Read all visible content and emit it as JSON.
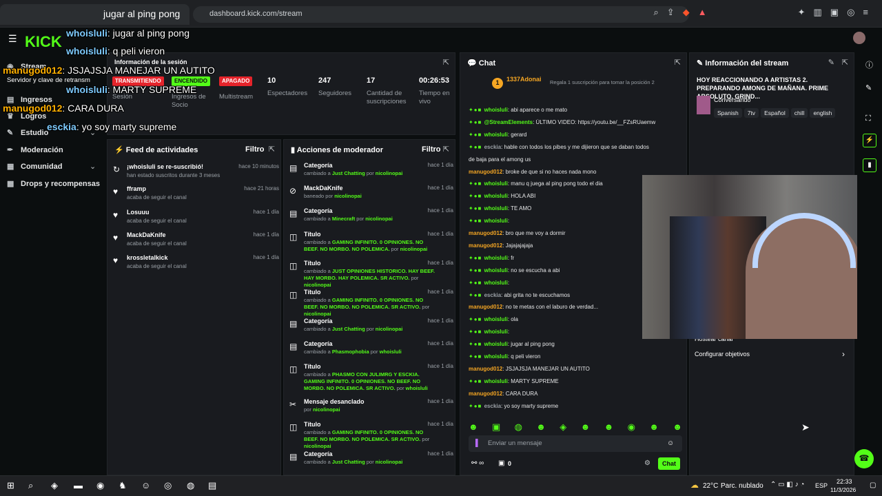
{
  "browser": {
    "tab_title": "jugar al ping pong",
    "url": "dashboard.kick.com/stream"
  },
  "app": {
    "logo": "KICK"
  },
  "sidebar": {
    "items": [
      {
        "label": "Stream",
        "icon": "broadcast-icon"
      },
      {
        "label": "Ingresos",
        "icon": "money-icon"
      },
      {
        "label": "Logros",
        "icon": "trophy-icon"
      },
      {
        "label": "Estudio",
        "icon": "studio-icon"
      },
      {
        "label": "Moderación",
        "icon": "wrench-icon"
      },
      {
        "label": "Comunidad",
        "icon": "community-icon"
      },
      {
        "label": "Drops y recompensas",
        "icon": "gift-icon"
      }
    ],
    "sub_info": "Información de la sesión",
    "sub_key": "Servidor y clave de retransm"
  },
  "session": {
    "badges": [
      "TRANSMITIENDO",
      "ENCENDIDO",
      "APAGADO"
    ],
    "labels": [
      "Sesión",
      "Ingresos de Socio",
      "Multistream"
    ],
    "stats": [
      {
        "value": "10",
        "label": "Espectadores"
      },
      {
        "value": "247",
        "label": "Seguidores"
      },
      {
        "value": "17",
        "label": "Cantidad de suscripciones"
      },
      {
        "value": "00:26:53",
        "label": "Tiempo en vivo"
      }
    ]
  },
  "feed": {
    "title": "Feed de actividades",
    "filter": "Filtro",
    "items": [
      {
        "name": "¡whoisluli se re-suscribió!",
        "sub": "han estado suscritos durante 3 meses",
        "time": "hace 10 minutos"
      },
      {
        "name": "fframp",
        "sub": "acaba de seguir el canal",
        "time": "hace 21 horas"
      },
      {
        "name": "Losuuu",
        "sub": "acaba de seguir el canal",
        "time": "hace 1 día"
      },
      {
        "name": "MackDaKnife",
        "sub": "acaba de seguir el canal",
        "time": "hace 1 día"
      },
      {
        "name": "krossletalkick",
        "sub": "acaba de seguir el canal",
        "time": "hace 1 día"
      }
    ]
  },
  "mod": {
    "title": "Acciones de moderador",
    "filter": "Filtro",
    "items": [
      {
        "name": "Categoría",
        "pre": "cambiado a ",
        "hl": "Just Chatting",
        "post": " por ",
        "by": "nicolinopai",
        "time": "hace 1 día"
      },
      {
        "name": "MackDaKnife",
        "pre": "baneado por ",
        "hl": "",
        "post": "",
        "by": "nicolinopai",
        "time": "hace 1 día"
      },
      {
        "name": "Categoría",
        "pre": "cambiado a ",
        "hl": "Minecraft",
        "post": " por ",
        "by": "nicolinopai",
        "time": "hace 1 día"
      },
      {
        "name": "Título",
        "pre": "cambiado a ",
        "hl": "GAMING INFINITO. 0 OPINIONES. NO BEEF. NO MORBO. NO POLEMICA.",
        "post": " por ",
        "by": "nicolinopai",
        "time": "hace 1 día"
      },
      {
        "name": "Título",
        "pre": "cambiado a ",
        "hl": "JUST OPINIONES HISTORICO. HAY BEEF. HAY MORBO. HAY POLEMICA. SR ACTIVO.",
        "post": " por ",
        "by": "nicolinopai",
        "time": "hace 1 día"
      },
      {
        "name": "Título",
        "pre": "cambiado a ",
        "hl": "GAMING INFINITO. 0 OPINIONES. NO BEEF. NO MORBO. NO POLEMICA. SR ACTIVO.",
        "post": " por ",
        "by": "nicolinopai",
        "time": "hace 1 día"
      },
      {
        "name": "Categoría",
        "pre": "cambiado a ",
        "hl": "Just Chatting",
        "post": " por ",
        "by": "nicolinopai",
        "time": "hace 1 día"
      },
      {
        "name": "Categoría",
        "pre": "cambiado a ",
        "hl": "Phasmophobia",
        "post": " por ",
        "by": "whoisluli",
        "time": "hace 1 día"
      },
      {
        "name": "Título",
        "pre": "cambiado a ",
        "hl": "PHASMO CON JULIMRG Y ESCKIA. GAMING INFINITO. 0 OPINIONES. NO BEEF. NO MORBO. NO POLEMICA. SR ACTIVO.",
        "post": " por ",
        "by": "whoisluli",
        "time": "hace 1 día"
      },
      {
        "name": "Mensaje desanclado",
        "pre": "por ",
        "hl": "",
        "post": "",
        "by": "nicolinopai",
        "time": "hace 1 día"
      },
      {
        "name": "Título",
        "pre": "cambiado a ",
        "hl": "GAMING INFINITO. 0 OPINIONES. NO BEEF. NO MORBO. NO POLEMICA. SR ACTIVO.",
        "post": " por ",
        "by": "nicolinopai",
        "time": "hace 1 día"
      },
      {
        "name": "Categoría",
        "pre": "cambiado a ",
        "hl": "Just Chatting",
        "post": " por ",
        "by": "nicolinopai",
        "time": "hace 1 día"
      }
    ]
  },
  "chat": {
    "title": "Chat",
    "top_user": "1337Adonai",
    "top_rank": "1",
    "gift_prompt": "Regala 1 suscripción para tomar la posición 2",
    "messages": [
      {
        "user": "whoisluli",
        "color": "green",
        "text": ": abi aparece o me mato"
      },
      {
        "user": "@StreamElements",
        "color": "green",
        "text": ": ÚLTIMO VIDEO: https://youtu.be/__FZsRUaemw"
      },
      {
        "user": "whoisluli",
        "color": "green",
        "text": ": gerard"
      },
      {
        "user": "esckia",
        "color": "grey",
        "text": ": hable con todos los pibes y me dijieron que se daban todos"
      },
      {
        "user": "",
        "color": "green",
        "text": "de baja para el among us"
      },
      {
        "user": "manugod012",
        "color": "orange",
        "text": ": broke de que si no haces nada mono"
      },
      {
        "user": "whoisluli",
        "color": "green",
        "text": ": manu q juega al ping pong todo el dia"
      },
      {
        "user": "whoisluli",
        "color": "green",
        "text": ": HOLA ABI"
      },
      {
        "user": "whoisluli",
        "color": "green",
        "text": ": TE AMO"
      },
      {
        "user": "whoisluli",
        "color": "green",
        "text": ":"
      },
      {
        "user": "manugod012",
        "color": "orange",
        "text": ": bro que me voy a dormir"
      },
      {
        "user": "manugod012",
        "color": "orange",
        "text": ": Jajajajajaja"
      },
      {
        "user": "whoisluli",
        "color": "green",
        "text": ": fr"
      },
      {
        "user": "whoisluli",
        "color": "green",
        "text": ": no se escucha a abi"
      },
      {
        "user": "whoisluli",
        "color": "green",
        "text": ":"
      },
      {
        "user": "esckia",
        "color": "grey",
        "text": ": abi grita no te escuchamos"
      },
      {
        "user": "manugod012",
        "color": "orange",
        "text": ": no te metas con el laburo de verdad..."
      },
      {
        "user": "whoisluli",
        "color": "green",
        "text": ": ola"
      },
      {
        "user": "whoisluli",
        "color": "green",
        "text": ":"
      },
      {
        "user": "whoisluli",
        "color": "green",
        "text": ": jugar al ping pong"
      },
      {
        "user": "whoisluli",
        "color": "green",
        "text": ": q peli vieron"
      },
      {
        "user": "manugod012",
        "color": "orange",
        "text": ": JSJAJSJA MANEJAR UN AUTITO"
      },
      {
        "user": "whoisluli",
        "color": "green",
        "text": ": MARTY SUPREME"
      },
      {
        "user": "manugod012",
        "color": "orange",
        "text": ": CARA DURA"
      },
      {
        "user": "esckia",
        "color": "grey",
        "text": ": yo soy marty supreme"
      }
    ],
    "input_placeholder": "Enviar un mensaje",
    "viewer_count": "0",
    "send_label": "Chat"
  },
  "stream_info": {
    "title": "Información del stream",
    "stream_title": "HOY REACCIONANDO A ARTISTAS 2. PREPARANDO AMONG DE MAÑANA. PRIME ABSOLUTO. GRIND...",
    "category": "Conversando",
    "tags": [
      "Spanish",
      "7tv",
      "Español",
      "chill",
      "english"
    ],
    "hosting": "Hostear canal",
    "goals": "Configurar objetivos"
  },
  "overlay": [
    {
      "user": "whoisluli",
      "color": "blue",
      "text": ": jugar al ping pong"
    },
    {
      "user": "whoisluli",
      "color": "blue",
      "text": ": q peli vieron"
    },
    {
      "user": "manugod012",
      "color": "orange",
      "text": ": JSJAJSJA MANEJAR UN AUTITO"
    },
    {
      "user": "whoisluli",
      "color": "blue",
      "text": ": MARTY SUPREME"
    },
    {
      "user": "manugod012",
      "color": "orange",
      "text": ": CARA DURA"
    },
    {
      "user": "esckia",
      "color": "blue",
      "text": ": yo soy marty supreme"
    }
  ],
  "taskbar": {
    "weather": "22°C",
    "weather_desc": "Parc. nublado",
    "lang": "ESP",
    "time": "22:33",
    "date": "11/3/2026"
  },
  "colors": {
    "brand": "#53fc18",
    "panel": "#191b1f",
    "orange": "#f5a623"
  }
}
